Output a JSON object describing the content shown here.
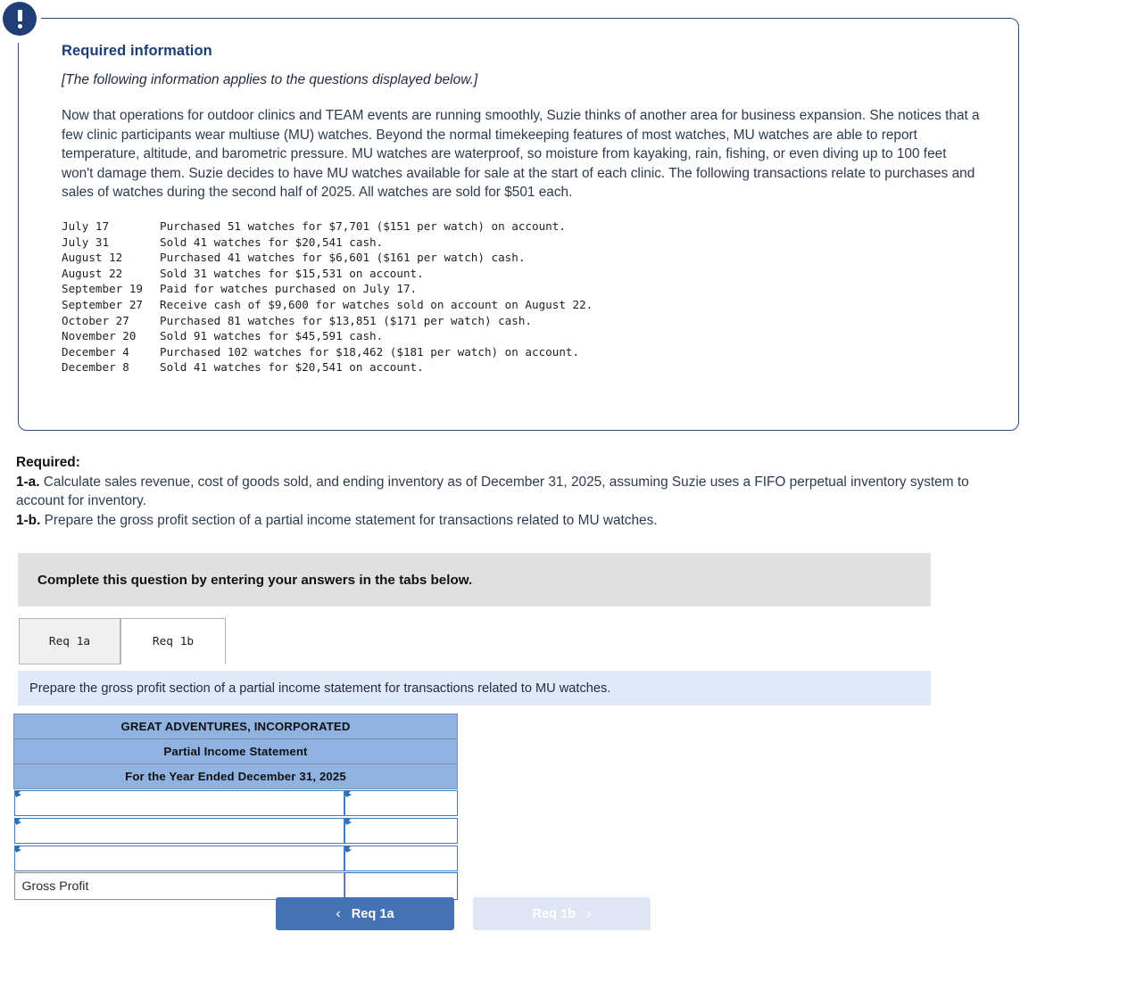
{
  "callout": {
    "icon": "exclamation-icon",
    "title": "Required information",
    "applies_note": "[The following information applies to the questions displayed below.]",
    "scenario": "Now that operations for outdoor clinics and TEAM events are running smoothly, Suzie thinks of another area for business expansion. She notices that a few clinic participants wear multiuse (MU) watches. Beyond the normal timekeeping features of most watches, MU watches are able to report temperature, altitude, and barometric pressure. MU watches are waterproof, so moisture from kayaking, rain, fishing, or even diving up to 100 feet won't damage them. Suzie decides to have MU watches available for sale at the start of each clinic. The following transactions relate to purchases and sales of watches during the second half of 2025. All watches are sold for $501 each.",
    "transactions": [
      {
        "date": "July 17",
        "description": "Purchased 51 watches for $7,701 ($151 per watch) on account."
      },
      {
        "date": "July 31",
        "description": "Sold 41 watches for $20,541 cash."
      },
      {
        "date": "August 12",
        "description": "Purchased 41 watches for $6,601 ($161 per watch) cash."
      },
      {
        "date": "August 22",
        "description": "Sold 31 watches for $15,531 on account."
      },
      {
        "date": "September 19",
        "description": "Paid for watches purchased on July 17."
      },
      {
        "date": "September 27",
        "description": "Receive cash of $9,600 for watches sold on account on August 22."
      },
      {
        "date": "October 27",
        "description": "Purchased 81 watches for $13,851 ($171 per watch) cash."
      },
      {
        "date": "November 20",
        "description": "Sold 91 watches for $45,591 cash."
      },
      {
        "date": "December 4",
        "description": "Purchased 102 watches for $18,462 ($181 per watch) on account."
      },
      {
        "date": "December 8",
        "description": "Sold 41 watches for $20,541 on account."
      }
    ]
  },
  "required": {
    "label": "Required:",
    "item_1a_lead": "1-a.",
    "item_1a_text": " Calculate sales revenue, cost of goods sold, and ending inventory as of December 31, 2025, assuming Suzie uses a FIFO perpetual inventory system to account for inventory.",
    "item_1b_lead": "1-b.",
    "item_1b_text": " Prepare the gross profit section of a partial income statement for transactions related to MU watches."
  },
  "complete_bar": {
    "text": "Complete this question by entering your answers in the tabs below."
  },
  "tabs": [
    {
      "label": "Req 1a",
      "active": false
    },
    {
      "label": "Req 1b",
      "active": true
    }
  ],
  "prompt_bar": {
    "text": "Prepare the gross profit section of a partial income statement for transactions related to MU watches."
  },
  "statement": {
    "header_rows": [
      "GREAT ADVENTURES, INCORPORATED",
      "Partial Income Statement",
      "For the Year Ended December 31, 2025"
    ],
    "entry_rows": [
      {
        "label": "",
        "amount": ""
      },
      {
        "label": "",
        "amount": ""
      },
      {
        "label": "",
        "amount": ""
      }
    ],
    "total_row": {
      "label": "Gross Profit",
      "amount": ""
    }
  },
  "nav": {
    "prev_label": "Req 1a",
    "prev_chevron": "chevron-left-icon",
    "next_label": "Req 1b",
    "next_chevron": "chevron-right-icon"
  },
  "colors": {
    "callout_border": "#2a4d86",
    "badge": "#1f3f76",
    "title_blue": "#1a3d73",
    "table_header_blue": "#8fb2e0",
    "input_border_blue": "#3f7ec4",
    "prompt_bar_blue": "#dfeaf8",
    "complete_bar_gray": "#e0e0e0",
    "btn_active_blue": "#4472b4",
    "btn_disabled_blue": "#dde6f2"
  }
}
